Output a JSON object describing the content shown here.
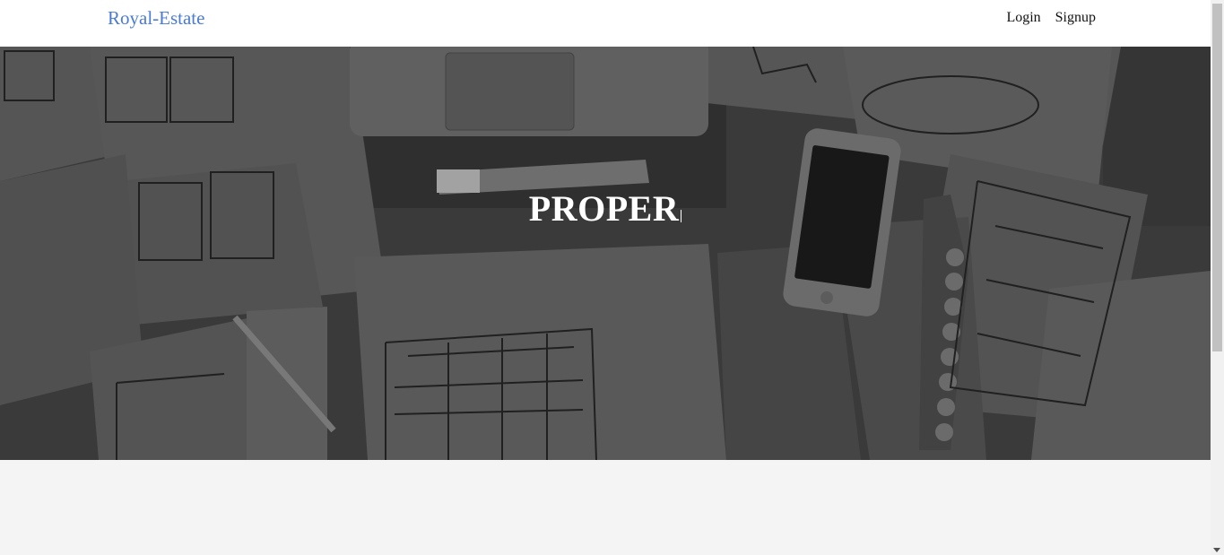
{
  "navbar": {
    "brand": "Royal-Estate",
    "links": [
      {
        "label": "Login"
      },
      {
        "label": "Signup"
      }
    ]
  },
  "hero": {
    "title": "PROPER"
  },
  "colors": {
    "brand": "#4a7bd6",
    "hero_overlay": "#5a5a5a",
    "page_bg": "#f4f4f4"
  }
}
